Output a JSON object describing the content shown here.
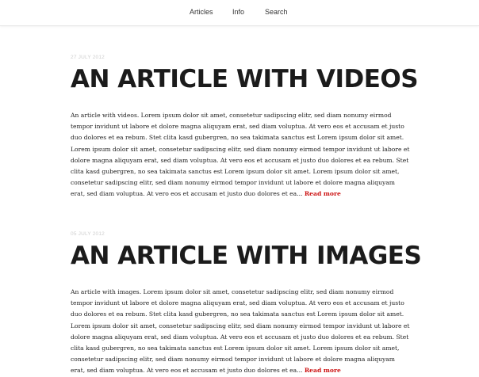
{
  "nav": {
    "items": [
      "Articles",
      "Info",
      "Search"
    ]
  },
  "articles": [
    {
      "date": "27 JULY 2012",
      "title": "AN ARTICLE WITH VIDEOS",
      "excerpt": "An article with videos. Lorem ipsum dolor sit amet, consetetur sadipscing elitr, sed diam nonumy eirmod tempor invidunt ut labore et dolore magna aliquyam erat, sed diam voluptua. At vero eos et accusam et justo duo dolores et ea rebum. Stet clita kasd gubergren, no sea takimata sanctus est Lorem ipsum dolor sit amet. Lorem ipsum dolor sit amet, consetetur sadipscing elitr, sed diam nonumy eirmod tempor invidunt ut labore et dolore magna aliquyam erat, sed diam voluptua. At vero eos et accusam et justo duo dolores et ea rebum. Stet clita kasd gubergren, no sea takimata sanctus est Lorem ipsum dolor sit amet. Lorem ipsum dolor sit amet, consetetur sadipscing elitr, sed diam nonumy eirmod tempor invidunt ut labore et dolore magna aliquyam erat, sed diam voluptua. At vero eos et accusam et justo duo dolores et ea...",
      "read_more": "Read more"
    },
    {
      "date": "05 JULY 2012",
      "title": "AN ARTICLE WITH IMAGES",
      "excerpt": "An article with images. Lorem ipsum dolor sit amet, consetetur sadipscing elitr, sed diam nonumy eirmod tempor invidunt ut labore et dolore magna aliquyam erat, sed diam voluptua. At vero eos et accusam et justo duo dolores et ea rebum. Stet clita kasd gubergren, no sea takimata sanctus est Lorem ipsum dolor sit amet. Lorem ipsum dolor sit amet, consetetur sadipscing elitr, sed diam nonumy eirmod tempor invidunt ut labore et dolore magna aliquyam erat, sed diam voluptua. At vero eos et accusam et justo duo dolores et ea rebum. Stet clita kasd gubergren, no sea takimata sanctus est Lorem ipsum dolor sit amet. Lorem ipsum dolor sit amet, consetetur sadipscing elitr, sed diam nonumy eirmod tempor invidunt ut labore et dolore magna aliquyam erat, sed diam voluptua. At vero eos et accusam et justo duo dolores et ea...",
      "read_more": "Read more"
    }
  ],
  "colors": {
    "read_more": "#cc1111",
    "title": "#1b1b1b",
    "date": "#cfcfcf",
    "nav_border": "#e6e6e6"
  }
}
